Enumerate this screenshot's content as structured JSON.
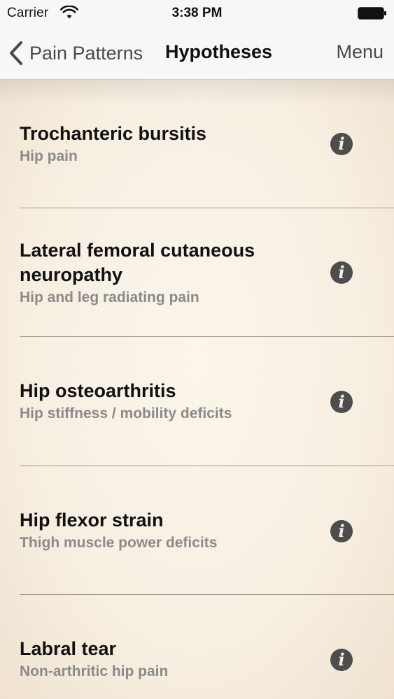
{
  "status_bar": {
    "carrier": "Carrier",
    "time": "3:38 PM"
  },
  "nav": {
    "back_label": "Pain Patterns",
    "title": "Hypotheses",
    "menu_label": "Menu"
  },
  "list": {
    "items": [
      {
        "title": "Trochanteric bursitis",
        "subtitle": "Hip pain"
      },
      {
        "title": "Lateral femoral cutaneous neuropathy",
        "subtitle": "Hip and leg radiating pain"
      },
      {
        "title": "Hip osteoarthritis",
        "subtitle": "Hip stiffness / mobility deficits"
      },
      {
        "title": "Hip flexor strain",
        "subtitle": "Thigh muscle power deficits"
      },
      {
        "title": "Labral tear",
        "subtitle": "Non-arthritic hip pain"
      }
    ],
    "info_glyph": "i"
  },
  "icons": {
    "wifi": "wifi-icon",
    "battery": "battery-icon",
    "back": "chevron-left-icon",
    "info": "info-icon"
  },
  "colors": {
    "background": "#f7efe3",
    "bar": "#f7f7f7",
    "title_text": "#111111",
    "subtitle_text": "#8a8a8a",
    "info_circle": "#4d4d4d",
    "divider": "#a59c91"
  }
}
